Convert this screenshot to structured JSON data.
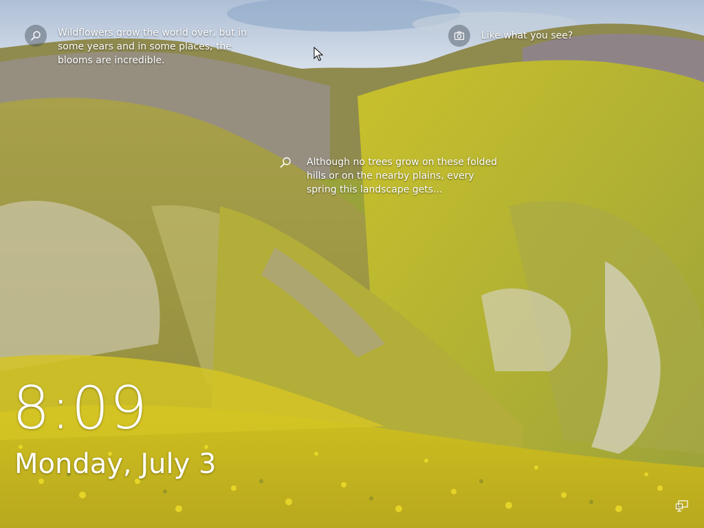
{
  "lock_screen": {
    "time": "8:09",
    "date": "Monday, July 3"
  },
  "spotlight": {
    "hotspot_1": {
      "icon": "search-icon",
      "text": "Wildflowers grow the world over, but in some years and in some places, the blooms are incredible."
    },
    "like_prompt": {
      "icon": "camera-icon",
      "text": "Like what you see?"
    },
    "hotspot_2": {
      "icon": "search-icon",
      "text": "Although no trees grow on these folded hills or on the nearby plains, every spring this landscape gets..."
    }
  },
  "status": {
    "network_icon": "network-icon"
  },
  "colors": {
    "text": "#ffffff",
    "sky": "#c9d6e6",
    "flowers": "#d6c81e",
    "purple_bloom": "#7a6fb0",
    "hillside": "#8f9a3a"
  }
}
